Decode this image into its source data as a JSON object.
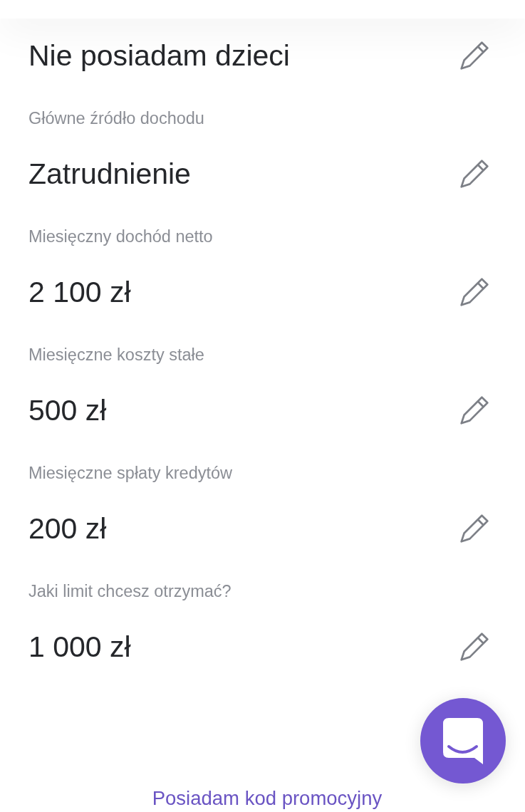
{
  "fields": [
    {
      "value": "Nie posiadam dzieci"
    },
    {
      "label": "Główne źródło dochodu",
      "value": "Zatrudnienie"
    },
    {
      "label": "Miesięczny dochód netto",
      "value": "2 100 zł"
    },
    {
      "label": "Miesięczne koszty stałe",
      "value": "500 zł"
    },
    {
      "label": "Miesięczne spłaty kredytów",
      "value": "200 zł"
    },
    {
      "label": "Jaki limit chcesz otrzymać?",
      "value": "1 000 zł"
    }
  ],
  "promo_link": {
    "label": "Posiadam kod promocyjny"
  }
}
